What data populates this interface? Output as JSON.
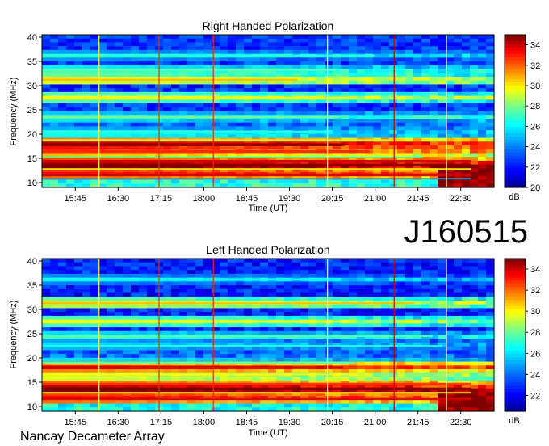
{
  "observation_id": "J160515",
  "footer_label": "Nancay Decameter Array",
  "chart_data": [
    {
      "type": "heatmap",
      "title": "Right Handed Polarization",
      "xlabel": "Time (UT)",
      "ylabel": "Frequency (MHz)",
      "x_tick_labels": [
        "15:45",
        "16:30",
        "17:15",
        "18:00",
        "18:45",
        "19:30",
        "20:15",
        "21:00",
        "21:45",
        "22:30"
      ],
      "x_range": [
        "15:10",
        "23:05"
      ],
      "ylim": [
        9,
        40.5
      ],
      "y_ticks": [
        10,
        15,
        20,
        25,
        30,
        35,
        40
      ],
      "colorbar": {
        "label": "dB",
        "range": [
          20,
          35
        ],
        "ticks": [
          20,
          22,
          24,
          26,
          28,
          30,
          32,
          34
        ]
      },
      "colormap": [
        "#000080",
        "#0000ff",
        "#00a0ff",
        "#00ffff",
        "#80ff80",
        "#ffff00",
        "#ff8000",
        "#ff0000",
        "#800000"
      ],
      "vertical_lines": [
        {
          "time": "16:10",
          "color": "#ffff40"
        },
        {
          "time": "17:13",
          "color": "#c04000"
        },
        {
          "time": "18:10",
          "color": "#ff2000"
        },
        {
          "time": "20:10",
          "color": "#ffff80"
        },
        {
          "time": "21:20",
          "color": "#c00000"
        },
        {
          "time": "22:15",
          "color": "#ffff80"
        }
      ],
      "bands": [
        {
          "mhz": 10.8,
          "level": 25
        },
        {
          "mhz": 11.6,
          "level": 34
        },
        {
          "mhz": 12.8,
          "level": 30
        },
        {
          "mhz": 13.6,
          "level": 36
        },
        {
          "mhz": 14.4,
          "level": 34
        },
        {
          "mhz": 15.2,
          "level": 27
        },
        {
          "mhz": 16.4,
          "level": 33
        },
        {
          "mhz": 17.8,
          "level": 35
        },
        {
          "mhz": 18.8,
          "level": 29
        },
        {
          "mhz": 20.5,
          "level": 27
        },
        {
          "mhz": 23.5,
          "level": 28
        },
        {
          "mhz": 27.5,
          "level": 30
        },
        {
          "mhz": 31.2,
          "level": 31
        },
        {
          "mhz": 33.2,
          "level": 28
        },
        {
          "mhz": 36.2,
          "level": 27
        }
      ]
    },
    {
      "type": "heatmap",
      "title": "Left Handed Polarization",
      "xlabel": "Time (UT)",
      "ylabel": "Frequency (MHz)",
      "x_tick_labels": [
        "15:45",
        "16:30",
        "17:15",
        "18:00",
        "18:45",
        "19:30",
        "20:15",
        "21:00",
        "21:45",
        "22:30"
      ],
      "x_range": [
        "15:10",
        "23:05"
      ],
      "ylim": [
        9,
        40.5
      ],
      "y_ticks": [
        10,
        15,
        20,
        25,
        30,
        35,
        40
      ],
      "colorbar": {
        "label": "dB",
        "range": [
          20.5,
          35
        ],
        "ticks": [
          22,
          24,
          26,
          28,
          30,
          32,
          34
        ]
      },
      "colormap": [
        "#000080",
        "#0000ff",
        "#00a0ff",
        "#00ffff",
        "#80ff80",
        "#ffff00",
        "#ff8000",
        "#ff0000",
        "#800000"
      ],
      "vertical_lines": [
        {
          "time": "16:10",
          "color": "#ffff40"
        },
        {
          "time": "17:13",
          "color": "#c04000"
        },
        {
          "time": "18:10",
          "color": "#ff2000"
        },
        {
          "time": "20:10",
          "color": "#ffff80"
        },
        {
          "time": "21:20",
          "color": "#c00000"
        },
        {
          "time": "22:15",
          "color": "#ffff80"
        }
      ],
      "bands": [
        {
          "mhz": 11.6,
          "level": 34
        },
        {
          "mhz": 12.8,
          "level": 30
        },
        {
          "mhz": 13.6,
          "level": 36
        },
        {
          "mhz": 14.6,
          "level": 33
        },
        {
          "mhz": 16.6,
          "level": 30
        },
        {
          "mhz": 18.0,
          "level": 34
        },
        {
          "mhz": 19.0,
          "level": 28
        },
        {
          "mhz": 22.5,
          "level": 27
        },
        {
          "mhz": 24.5,
          "level": 28
        },
        {
          "mhz": 27.5,
          "level": 30
        },
        {
          "mhz": 31.3,
          "level": 31
        },
        {
          "mhz": 36.2,
          "level": 27
        }
      ]
    }
  ]
}
